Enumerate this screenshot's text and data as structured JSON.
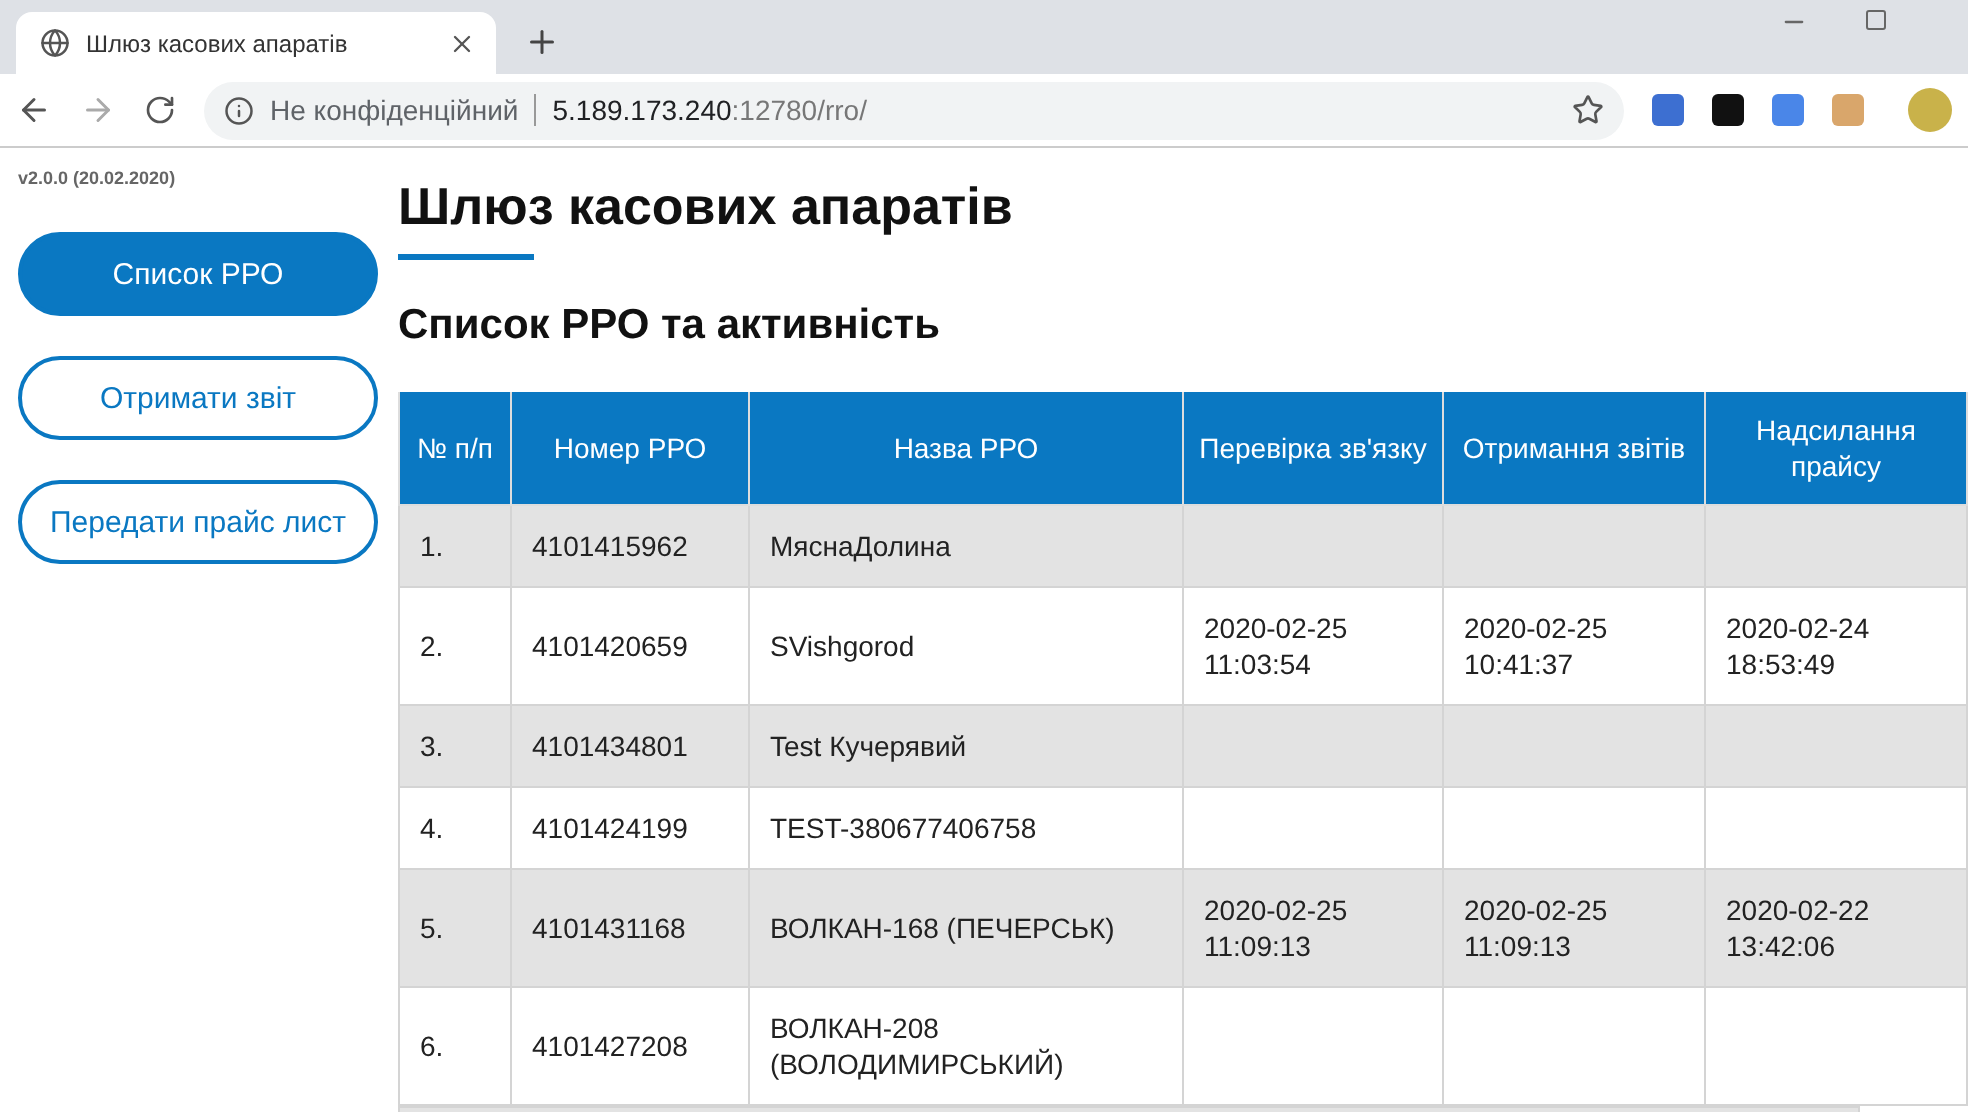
{
  "browser": {
    "tab_title": "Шлюз касових апаратів",
    "security_label": "Не конфіденційний",
    "url_host": "5.189.173.240",
    "url_rest": ":12780/rro/"
  },
  "sidebar": {
    "version": "v2.0.0 (20.02.2020)",
    "items": [
      {
        "label": "Список РРО",
        "selected": true
      },
      {
        "label": "Отримати звіт",
        "selected": false
      },
      {
        "label": "Передати прайс лист",
        "selected": false
      }
    ]
  },
  "page": {
    "title": "Шлюз касових апаратів",
    "subtitle": "Список РРО та активність"
  },
  "table": {
    "columns": [
      "№ п/п",
      "Номер РРО",
      "Назва РРО",
      "Перевірка зв'язку",
      "Отримання звітів",
      "Надсилання прайсу"
    ],
    "rows": [
      [
        "1.",
        "4101415962",
        "МяснаДолина",
        "",
        "",
        ""
      ],
      [
        "2.",
        "4101420659",
        "SVishgorod",
        "2020-02-25 11:03:54",
        "2020-02-25 10:41:37",
        "2020-02-24 18:53:49"
      ],
      [
        "3.",
        "4101434801",
        "Test Кучерявий",
        "",
        "",
        ""
      ],
      [
        "4.",
        "4101424199",
        "TEST-380677406758",
        "",
        "",
        ""
      ],
      [
        "5.",
        "4101431168",
        "ВОЛКАН-168 (ПЕЧЕРСЬК)",
        "2020-02-25 11:09:13",
        "2020-02-25 11:09:13",
        "2020-02-22 13:42:06"
      ],
      [
        "6.",
        "4101427208",
        "ВОЛКАН-208 (ВОЛОДИМИРСЬКИЙ)",
        "",
        "",
        ""
      ]
    ]
  }
}
